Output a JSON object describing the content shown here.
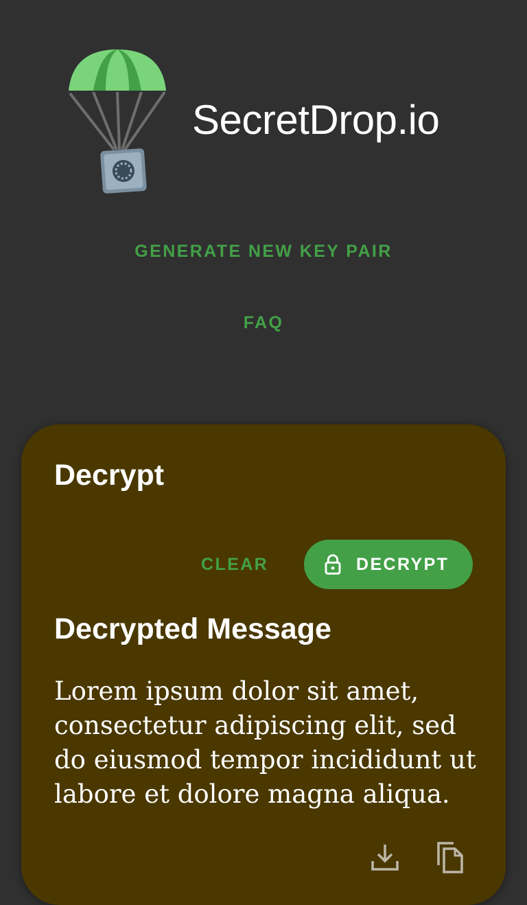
{
  "app": {
    "title": "SecretDrop.io"
  },
  "nav": {
    "generate_label": "GENERATE NEW KEY PAIR",
    "faq_label": "FAQ"
  },
  "decrypt_card": {
    "title": "Decrypt",
    "clear_label": "CLEAR",
    "decrypt_label": "DECRYPT",
    "result_title": "Decrypted Message",
    "message": "Lorem ipsum dolor sit amet, consectetur adipiscing elit, sed do eiusmod tempor incididunt ut labore et dolore magna aliqua."
  },
  "icons": {
    "logo": "parachute-safe-logo",
    "decrypt_button": "lock-icon",
    "download": "download-icon",
    "copy": "copy-icon"
  },
  "colors": {
    "background": "#303030",
    "card": "#4a3800",
    "accent": "#43a047",
    "text": "#ffffff"
  }
}
